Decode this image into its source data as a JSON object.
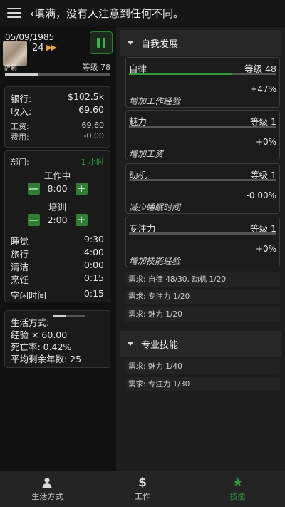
{
  "header": {
    "ticker": "‹填满，没有人注意到任何不同。"
  },
  "status": {
    "date": "05/09/1985",
    "avatar_name": "萨莉",
    "age": "24",
    "ff": "▶▶",
    "level": "等级 78",
    "xp_fraction": 0.32
  },
  "finance": {
    "bank_label": "银行:",
    "bank_value": "$102.5k",
    "income_label": "收入:",
    "income_value": "69.60",
    "salary_label": "工资:",
    "salary_value": "69.60",
    "expense_label": "费用:",
    "expense_value": "-0.00"
  },
  "schedule": {
    "dept_label": "部门:",
    "dept_value": "1 小时",
    "work_label": "工作中",
    "work_time": "8:00",
    "training_label": "培训",
    "training_time": "2:00",
    "minus": "—",
    "plus": "+",
    "rows": [
      {
        "label": "睡觉",
        "value": "9:30"
      },
      {
        "label": "旅行",
        "value": "4:00"
      },
      {
        "label": "清洁",
        "value": "0:00"
      },
      {
        "label": "烹饪",
        "value": "0:15"
      }
    ],
    "free_label": "空闲时间",
    "free_value": "0:15"
  },
  "lifestyle": {
    "label": "生活方式:",
    "bar_fraction": 0.4,
    "exp": "经验 × 60.00",
    "death": "死亡率: 0.42%",
    "years": "平均剩余年数: 25"
  },
  "self_dev": {
    "title": "自我发展",
    "skills": [
      {
        "name": "自律",
        "level": "等级 48",
        "fraction": 0.7,
        "pct": "+47%",
        "effect": "增加工作经验"
      },
      {
        "name": "魅力",
        "level": "等级 1",
        "fraction": 0.0,
        "pct": "+0%",
        "effect": "增加工资"
      },
      {
        "name": "动机",
        "level": "等级 1",
        "fraction": 0.0,
        "pct": "-0.00%",
        "effect": "减少睡眠时间"
      },
      {
        "name": "专注力",
        "level": "等级 1",
        "fraction": 0.0,
        "pct": "+0%",
        "effect": "增加技能经验"
      }
    ],
    "requirements": [
      "需求: 自律 48/30, 动机 1/20",
      "需求: 专注力 1/20",
      "需求: 魅力 1/20"
    ]
  },
  "pro_skills": {
    "title": "专业技能",
    "requirements": [
      "需求: 魅力 1/40",
      "需求: 专注力 1/30"
    ]
  },
  "nav": {
    "tabs": [
      {
        "label": "生活方式",
        "icon": "person-icon"
      },
      {
        "label": "工作",
        "icon": "dollar-icon"
      },
      {
        "label": "技能",
        "icon": "star-icon"
      }
    ],
    "dollar_glyph": "$",
    "star_glyph": "★"
  },
  "colors": {
    "accent": "#2e9e3a",
    "ff": "#e0a43b"
  }
}
